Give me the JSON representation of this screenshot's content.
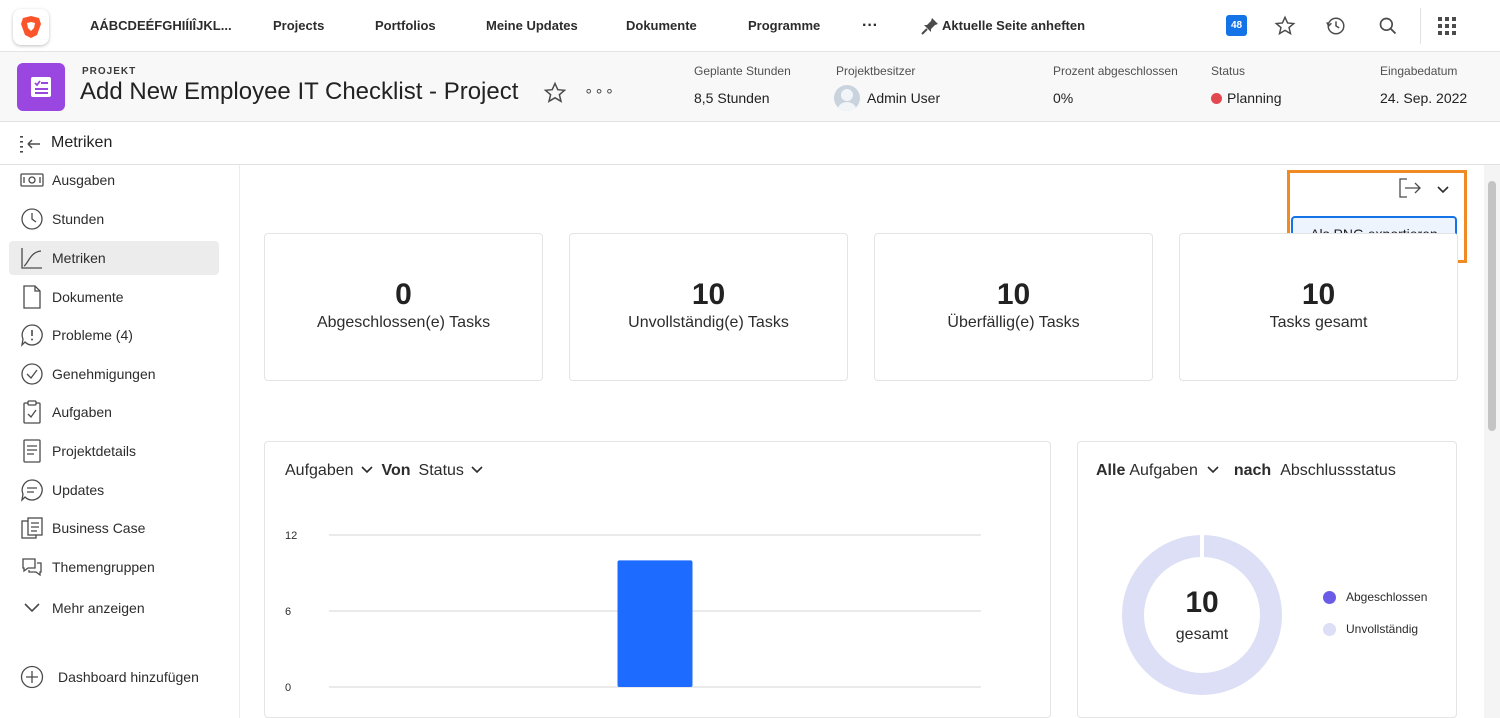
{
  "topnav": {
    "workspace": "AÁBCDEÉFGHIÍIÎJKL...",
    "items": [
      "Projects",
      "Portfolios",
      "Meine Updates",
      "Dokumente",
      "Programme"
    ],
    "more": "···",
    "pin_label": "Aktuelle Seite anheften",
    "notifications_count": "48"
  },
  "header": {
    "type_label": "PROJEKT",
    "title": "Add New Employee IT Checklist - Project",
    "more": "∘∘∘",
    "meta": {
      "planned_hours_label": "Geplante Stunden",
      "planned_hours_value": "8,5 Stunden",
      "owner_label": "Projektbesitzer",
      "owner_value": "Admin User",
      "percent_label": "Prozent abgeschlossen",
      "percent_value": "0%",
      "status_label": "Status",
      "status_value": "Planning",
      "entry_label": "Eingabedatum",
      "entry_value": "24. Sep. 2022"
    }
  },
  "subbar": {
    "title": "Metriken"
  },
  "sidebar": {
    "items": [
      {
        "label": "Ausgaben",
        "icon": "money-icon"
      },
      {
        "label": "Stunden",
        "icon": "clock-icon"
      },
      {
        "label": "Metriken",
        "icon": "chart-line-icon",
        "active": true
      },
      {
        "label": "Dokumente",
        "icon": "document-icon"
      },
      {
        "label": "Probleme (4)",
        "icon": "alert-icon"
      },
      {
        "label": "Genehmigungen",
        "icon": "check-circle-icon"
      },
      {
        "label": "Aufgaben",
        "icon": "clipboard-icon"
      },
      {
        "label": "Projektdetails",
        "icon": "details-icon"
      },
      {
        "label": "Updates",
        "icon": "chat-icon"
      },
      {
        "label": "Business Case",
        "icon": "business-case-icon"
      },
      {
        "label": "Themengruppen",
        "icon": "groups-icon"
      },
      {
        "label": "Mehr anzeigen",
        "icon": "chevron-down-icon"
      }
    ],
    "add_dashboard": "Dashboard hinzufügen"
  },
  "export": {
    "button_label": "Als PNG exportieren"
  },
  "kpis": [
    {
      "value": "0",
      "label": "Abgeschlossen(e) Tasks"
    },
    {
      "value": "10",
      "label": "Unvollständig(e) Tasks"
    },
    {
      "value": "10",
      "label": "Überfällig(e) Tasks"
    },
    {
      "value": "10",
      "label": "Tasks gesamt"
    }
  ],
  "bar_panel": {
    "head_1": "Aufgaben",
    "head_2": "Von",
    "head_3": "Status"
  },
  "donut_panel": {
    "head_1": "Alle",
    "head_2": "Aufgaben",
    "head_3": "nach",
    "head_4": "Abschlussstatus",
    "center_value": "10",
    "center_label": "gesamt"
  },
  "colors": {
    "accent": "#1473e6",
    "bar": "#1d6cff",
    "completed": "#6b5ce7",
    "incomplete": "#dcdff5",
    "status_red": "#e34850",
    "highlight": "#f08a24"
  },
  "chart_data": [
    {
      "type": "bar",
      "title": "Aufgaben Von Status",
      "ylim": [
        0,
        12
      ],
      "yticks": [
        "12",
        "6",
        "0"
      ],
      "categories": [
        ""
      ],
      "values": [
        10
      ]
    },
    {
      "type": "pie",
      "title": "Alle Aufgaben nach Abschlussstatus",
      "labels": [
        "Abgeschlossen",
        "Unvollständig"
      ],
      "values": [
        0,
        10
      ]
    }
  ]
}
